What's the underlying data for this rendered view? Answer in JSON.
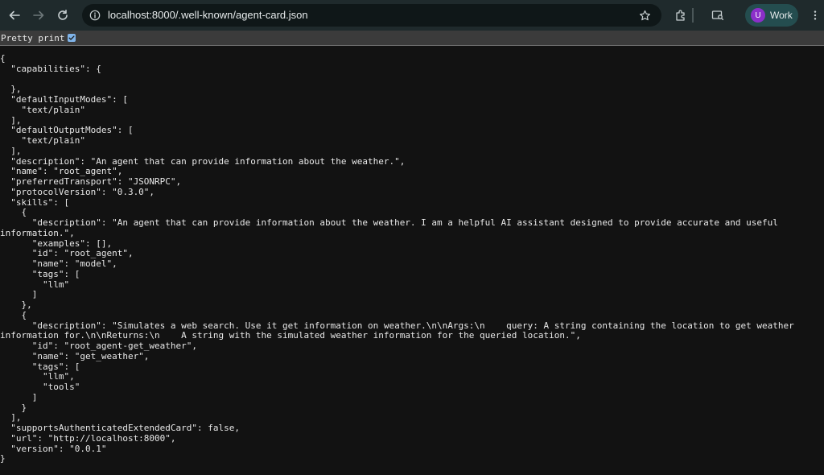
{
  "browser": {
    "url": "localhost:8000/.well-known/agent-card.json",
    "profile_initial": "U",
    "profile_label": "Work"
  },
  "pretty_print": {
    "label": "Pretty print",
    "checked": true
  },
  "json_lines": [
    "{",
    "  \"capabilities\": {",
    "",
    "  },",
    "  \"defaultInputModes\": [",
    "    \"text/plain\"",
    "  ],",
    "  \"defaultOutputModes\": [",
    "    \"text/plain\"",
    "  ],",
    "  \"description\": \"An agent that can provide information about the weather.\",",
    "  \"name\": \"root_agent\",",
    "  \"preferredTransport\": \"JSONRPC\",",
    "  \"protocolVersion\": \"0.3.0\",",
    "  \"skills\": [",
    "    {",
    "      \"description\": \"An agent that can provide information about the weather. I am a helpful AI assistant designed to provide accurate and useful",
    "information.\",",
    "      \"examples\": [],",
    "      \"id\": \"root_agent\",",
    "      \"name\": \"model\",",
    "      \"tags\": [",
    "        \"llm\"",
    "      ]",
    "    },",
    "    {",
    "      \"description\": \"Simulates a web search. Use it get information on weather.\\n\\nArgs:\\n    query: A string containing the location to get weather",
    "information for.\\n\\nReturns:\\n    A string with the simulated weather information for the queried location.\",",
    "      \"id\": \"root_agent-get_weather\",",
    "      \"name\": \"get_weather\",",
    "      \"tags\": [",
    "        \"llm\",",
    "        \"tools\"",
    "      ]",
    "    }",
    "  ],",
    "  \"supportsAuthenticatedExtendedCard\": false,",
    "  \"url\": \"http://localhost:8000\",",
    "  \"version\": \"0.0.1\"",
    "}"
  ]
}
